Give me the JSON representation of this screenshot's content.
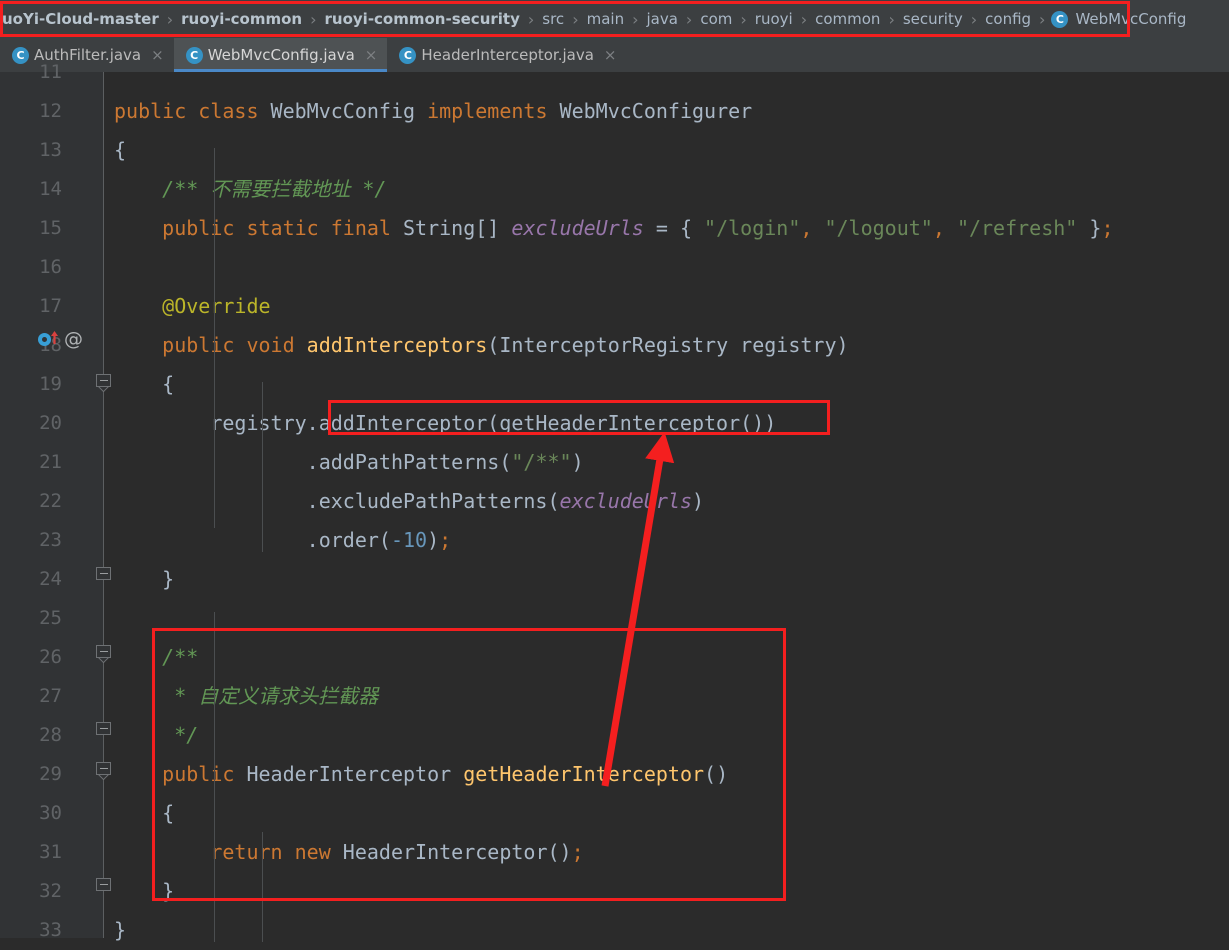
{
  "window": {
    "theme_background": "#2b2b2b",
    "accent_blue": "#4a88c7",
    "annotation_red": "#f41f1f"
  },
  "breadcrumb": {
    "name": "navigation-breadcrumb",
    "separator": "›",
    "items": [
      {
        "label": "uoYi-Cloud-master",
        "bold": true,
        "icon": ""
      },
      {
        "label": "ruoyi-common",
        "bold": true,
        "icon": ""
      },
      {
        "label": "ruoyi-common-security",
        "bold": true,
        "icon": ""
      },
      {
        "label": "src",
        "bold": false,
        "icon": ""
      },
      {
        "label": "main",
        "bold": false,
        "icon": ""
      },
      {
        "label": "java",
        "bold": false,
        "icon": ""
      },
      {
        "label": "com",
        "bold": false,
        "icon": ""
      },
      {
        "label": "ruoyi",
        "bold": false,
        "icon": ""
      },
      {
        "label": "common",
        "bold": false,
        "icon": ""
      },
      {
        "label": "security",
        "bold": false,
        "icon": ""
      },
      {
        "label": "config",
        "bold": false,
        "icon": ""
      },
      {
        "label": "WebMvcConfig",
        "bold": false,
        "icon": "java-class-icon",
        "badge": "C"
      }
    ]
  },
  "tabs": [
    {
      "label": "AuthFilter.java",
      "badge": "C",
      "active": false,
      "close": "×"
    },
    {
      "label": "WebMvcConfig.java",
      "badge": "C",
      "active": true,
      "close": "×"
    },
    {
      "label": "HeaderInterceptor.java",
      "badge": "C",
      "active": false,
      "close": "×"
    }
  ],
  "editor": {
    "file": "WebMvcConfig.java",
    "first_visible_line": 11,
    "lines": [
      {
        "no": "11",
        "segments": []
      },
      {
        "no": "12",
        "segments": [
          {
            "t": "public ",
            "c": "kw"
          },
          {
            "t": "class ",
            "c": "kw"
          },
          {
            "t": "WebMvcConfig ",
            "c": "cls"
          },
          {
            "t": "implements ",
            "c": "kw"
          },
          {
            "t": "WebMvcConfigurer",
            "c": "cls"
          }
        ]
      },
      {
        "no": "13",
        "segments": [
          {
            "t": "{",
            "c": "brc"
          }
        ]
      },
      {
        "no": "14",
        "segments": [
          {
            "t": "    /** 不需要拦截地址 */",
            "c": "cmt"
          }
        ]
      },
      {
        "no": "15",
        "segments": [
          {
            "t": "    ",
            "c": "pun"
          },
          {
            "t": "public static final ",
            "c": "kw"
          },
          {
            "t": "String[] ",
            "c": "cls"
          },
          {
            "t": "excludeUrls",
            "c": "fld"
          },
          {
            "t": " = { ",
            "c": "pun"
          },
          {
            "t": "\"/login\"",
            "c": "str"
          },
          {
            "t": ", ",
            "c": "semi"
          },
          {
            "t": "\"/logout\"",
            "c": "str"
          },
          {
            "t": ", ",
            "c": "semi"
          },
          {
            "t": "\"/refresh\"",
            "c": "str"
          },
          {
            "t": " }",
            "c": "pun"
          },
          {
            "t": ";",
            "c": "semi"
          }
        ]
      },
      {
        "no": "16",
        "segments": []
      },
      {
        "no": "17",
        "segments": [
          {
            "t": "    @Override",
            "c": "anno"
          }
        ]
      },
      {
        "no": "18",
        "segments": [
          {
            "t": "    ",
            "c": "pun"
          },
          {
            "t": "public void ",
            "c": "kw"
          },
          {
            "t": "addInterceptors",
            "c": "mtd"
          },
          {
            "t": "(",
            "c": "pun"
          },
          {
            "t": "InterceptorRegistry registry",
            "c": "cls"
          },
          {
            "t": ")",
            "c": "pun"
          }
        ]
      },
      {
        "no": "19",
        "segments": [
          {
            "t": "    {",
            "c": "brc"
          }
        ]
      },
      {
        "no": "20",
        "segments": [
          {
            "t": "        registry.addInterceptor(getHeaderInterceptor())",
            "c": "cls"
          }
        ]
      },
      {
        "no": "21",
        "segments": [
          {
            "t": "                .addPathPatterns(",
            "c": "cls"
          },
          {
            "t": "\"/**\"",
            "c": "str"
          },
          {
            "t": ")",
            "c": "pun"
          }
        ]
      },
      {
        "no": "22",
        "segments": [
          {
            "t": "                .excludePathPatterns(",
            "c": "cls"
          },
          {
            "t": "excludeUrls",
            "c": "fld"
          },
          {
            "t": ")",
            "c": "pun"
          }
        ]
      },
      {
        "no": "23",
        "segments": [
          {
            "t": "                .order(",
            "c": "cls"
          },
          {
            "t": "-10",
            "c": "num"
          },
          {
            "t": ")",
            "c": "pun"
          },
          {
            "t": ";",
            "c": "semi"
          }
        ]
      },
      {
        "no": "24",
        "segments": [
          {
            "t": "    }",
            "c": "brc"
          }
        ]
      },
      {
        "no": "25",
        "segments": []
      },
      {
        "no": "26",
        "segments": [
          {
            "t": "    /**",
            "c": "cmt"
          }
        ]
      },
      {
        "no": "27",
        "segments": [
          {
            "t": "     * 自定义请求头拦截器",
            "c": "cmt"
          }
        ]
      },
      {
        "no": "28",
        "segments": [
          {
            "t": "     */",
            "c": "cmt"
          }
        ]
      },
      {
        "no": "29",
        "segments": [
          {
            "t": "    ",
            "c": "pun"
          },
          {
            "t": "public ",
            "c": "kw"
          },
          {
            "t": "HeaderInterceptor ",
            "c": "cls"
          },
          {
            "t": "getHeaderInterceptor",
            "c": "mtd"
          },
          {
            "t": "()",
            "c": "pun"
          }
        ]
      },
      {
        "no": "30",
        "segments": [
          {
            "t": "    {",
            "c": "brc"
          }
        ]
      },
      {
        "no": "31",
        "segments": [
          {
            "t": "        ",
            "c": "pun"
          },
          {
            "t": "return new ",
            "c": "kw"
          },
          {
            "t": "HeaderInterceptor()",
            "c": "cls"
          },
          {
            "t": ";",
            "c": "semi"
          }
        ]
      },
      {
        "no": "32",
        "segments": [
          {
            "t": "    }",
            "c": "brc"
          }
        ]
      },
      {
        "no": "33",
        "segments": [
          {
            "t": "}",
            "c": "brc"
          }
        ]
      }
    ],
    "gutter_icons": [
      {
        "line": "18",
        "icon": "implementing-method-icon",
        "glyph": "↑"
      },
      {
        "line": "18",
        "icon": "annotation-at-icon",
        "glyph": "@"
      }
    ]
  },
  "annotations": {
    "highlight_box_call": {
      "name": "annotation-box-add-interceptor",
      "target_text": "addInterceptor(getHeaderInterceptor())"
    },
    "highlight_box_method": {
      "name": "annotation-box-get-header-interceptor-method",
      "target_text": "public HeaderInterceptor getHeaderInterceptor()"
    },
    "arrow": {
      "name": "annotation-arrow",
      "from": "getHeaderInterceptor method definition",
      "to": "addInterceptor(getHeaderInterceptor()) call"
    }
  }
}
